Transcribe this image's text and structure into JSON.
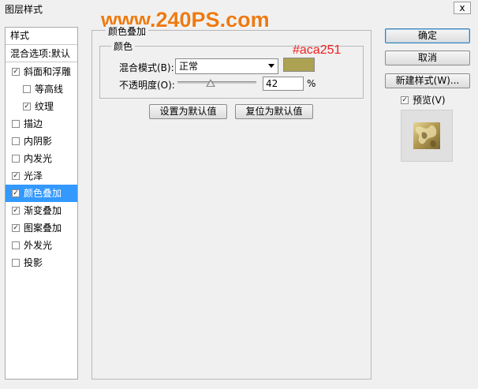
{
  "window": {
    "title": "图层样式",
    "close_label": "x"
  },
  "watermark": "www.240PS.com",
  "styles_panel": {
    "header": "样式",
    "blend_options": "混合选项:默认",
    "items": [
      {
        "label": "斜面和浮雕",
        "checked": true,
        "indent": false,
        "selected": false
      },
      {
        "label": "等高线",
        "checked": false,
        "indent": true,
        "selected": false
      },
      {
        "label": "纹理",
        "checked": true,
        "indent": true,
        "selected": false
      },
      {
        "label": "描边",
        "checked": false,
        "indent": false,
        "selected": false
      },
      {
        "label": "内阴影",
        "checked": false,
        "indent": false,
        "selected": false
      },
      {
        "label": "内发光",
        "checked": false,
        "indent": false,
        "selected": false
      },
      {
        "label": "光泽",
        "checked": true,
        "indent": false,
        "selected": false
      },
      {
        "label": "颜色叠加",
        "checked": true,
        "indent": false,
        "selected": true
      },
      {
        "label": "渐变叠加",
        "checked": true,
        "indent": false,
        "selected": false
      },
      {
        "label": "图案叠加",
        "checked": true,
        "indent": false,
        "selected": false
      },
      {
        "label": "外发光",
        "checked": false,
        "indent": false,
        "selected": false
      },
      {
        "label": "投影",
        "checked": false,
        "indent": false,
        "selected": false
      }
    ]
  },
  "color_overlay": {
    "group_title": "颜色叠加",
    "color_group_title": "颜色",
    "blend_mode_label": "混合模式(B):",
    "blend_mode_value": "正常",
    "swatch_color": "#aca251",
    "hex_annotation": "#aca251",
    "opacity_label": "不透明度(O):",
    "opacity_value": "42",
    "opacity_unit": "%",
    "opacity_fraction": 0.42,
    "set_default_button": "设置为默认值",
    "reset_default_button": "复位为默认值"
  },
  "right_panel": {
    "ok_button": "确定",
    "cancel_button": "取消",
    "new_style_button": "新建样式(W)...",
    "preview_label": "预览(V)",
    "preview_checked": true
  }
}
